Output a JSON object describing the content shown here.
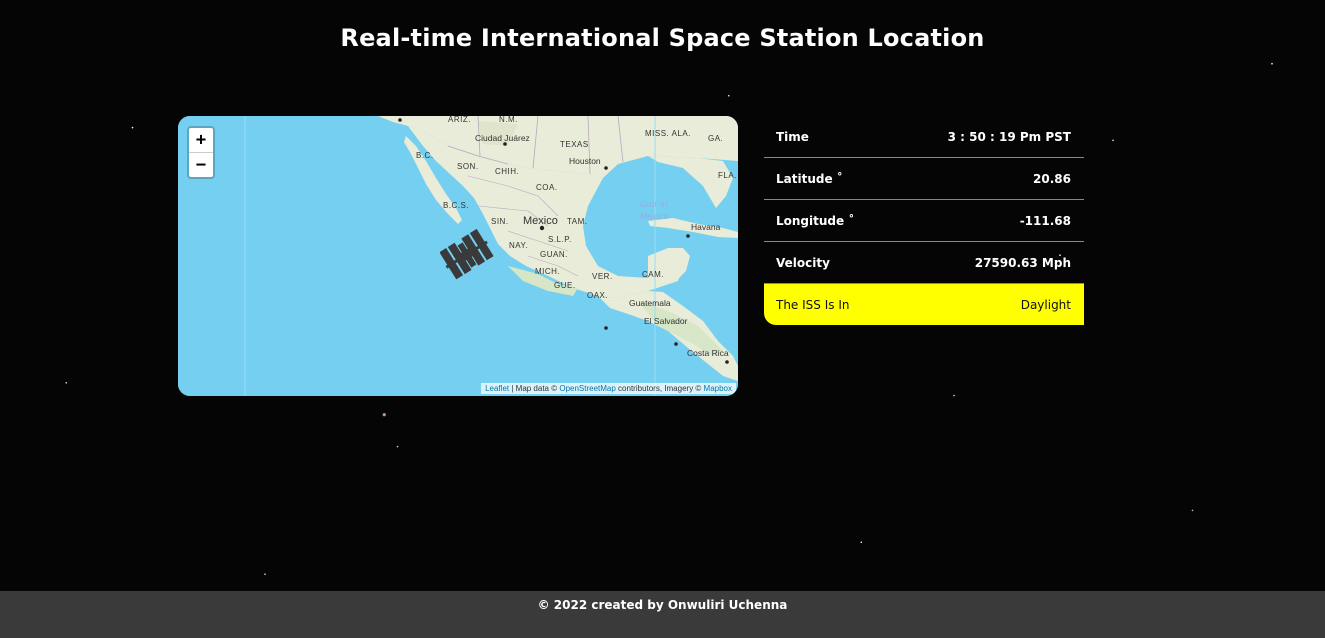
{
  "page": {
    "title": "Real-time International Space Station Location",
    "footer": "© 2022 created by Onwuliri Uchenna"
  },
  "map": {
    "zoom_in_label": "+",
    "zoom_out_label": "−",
    "attribution": {
      "leaflet": "Leaflet",
      "sep1": " | Map data © ",
      "osm": "OpenStreetMap",
      "mid": " contributors, Imagery © ",
      "mapbox": "Mapbox"
    },
    "labels": {
      "ariz": "ARIZ.",
      "nm": "N.M.",
      "ciudad_juarez": "Ciudad Juárez",
      "texas": "TEXAS",
      "miss_ala": "MISS. ALA.",
      "ga": "GA.",
      "bc": "B.C.",
      "son": "SON.",
      "chih": "CHIH.",
      "houston": "Houston",
      "fla": "FLA.",
      "coa": "COA.",
      "bcs": "B.C.S.",
      "sin": "SIN.",
      "mexico": "Mexico",
      "tam": "TAM.",
      "gulf": "Gulf of",
      "gulf2": "Mexico",
      "havana": "Havana",
      "slp": "S.L.P.",
      "nay": "NAY.",
      "guan": "GUAN.",
      "mich": "MICH.",
      "ver": "VER.",
      "cam": "CAM.",
      "gue": "GUE.",
      "oax": "OAX.",
      "guatemala": "Guatemala",
      "el_salvador": "El Salvador",
      "costa_rica": "Costa Rica"
    },
    "marker_icon": "iss-satellite-icon"
  },
  "info": {
    "rows": [
      {
        "label": "Time",
        "value": "3 : 50 : 19 Pm PST"
      },
      {
        "label": "Latitude ˚",
        "value": "20.86"
      },
      {
        "label": "Longitude ˚",
        "value": "-111.68"
      },
      {
        "label": "Velocity",
        "value": "27590.63 Mph"
      },
      {
        "label": "The ISS Is In",
        "value": "Daylight"
      }
    ],
    "highlight_color": "#ffff00"
  }
}
